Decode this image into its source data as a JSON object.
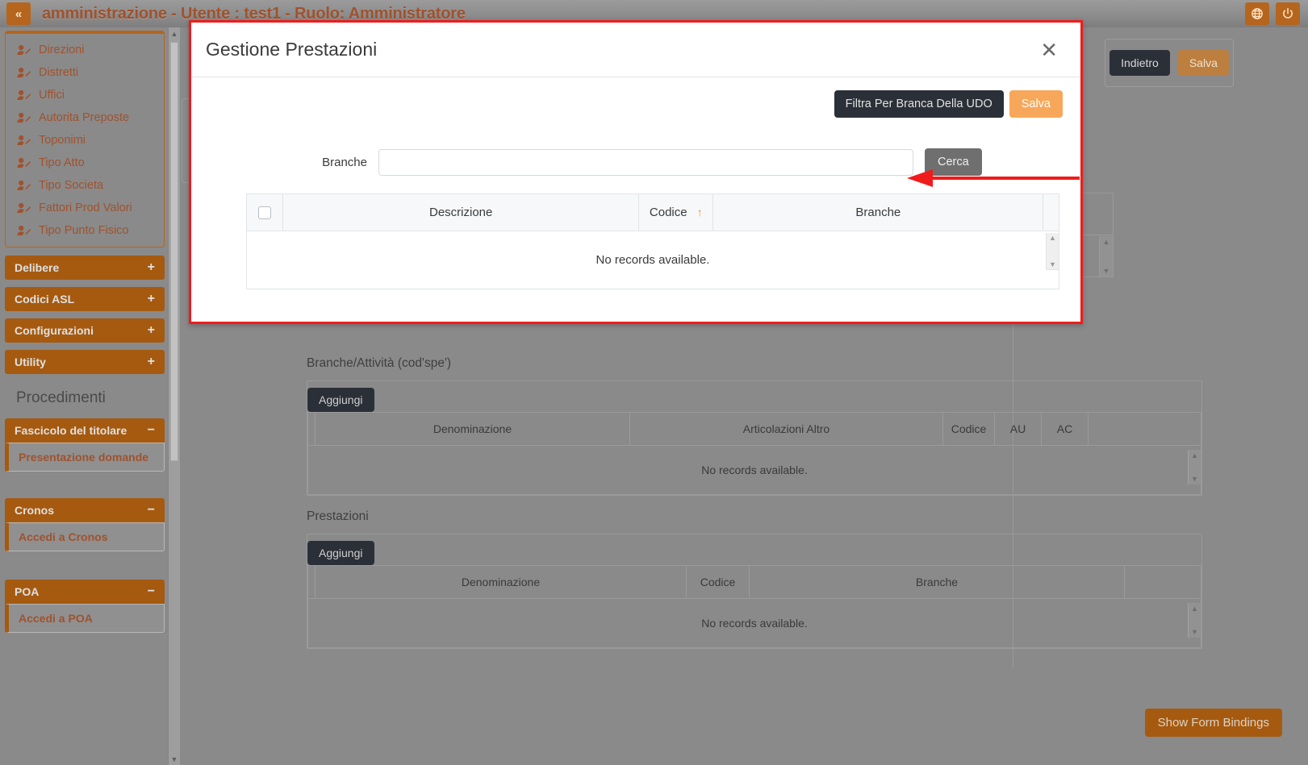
{
  "topbar": {
    "collapse_icon": "double-chevron-left-icon",
    "title": "amministrazione - Utente : test1 - Ruolo: Amministratore",
    "globe_icon": "globe-icon",
    "power_icon": "power-icon"
  },
  "sidebar": {
    "nav_items": [
      {
        "label": "Direzioni",
        "icon": "user-edit-icon"
      },
      {
        "label": "Distretti",
        "icon": "user-edit-icon"
      },
      {
        "label": "Uffici",
        "icon": "user-edit-icon"
      },
      {
        "label": "Autorita Preposte",
        "icon": "user-edit-icon"
      },
      {
        "label": "Toponimi",
        "icon": "user-edit-icon"
      },
      {
        "label": "Tipo Atto",
        "icon": "user-edit-icon"
      },
      {
        "label": "Tipo Societa",
        "icon": "user-edit-icon"
      },
      {
        "label": "Fattori Prod Valori",
        "icon": "user-edit-icon"
      },
      {
        "label": "Tipo Punto Fisico",
        "icon": "user-edit-icon"
      }
    ],
    "collapsed_groups": [
      {
        "label": "Delibere",
        "sign": "+"
      },
      {
        "label": "Codici ASL",
        "sign": "+"
      },
      {
        "label": "Configurazioni",
        "sign": "+"
      },
      {
        "label": "Utility",
        "sign": "+"
      }
    ],
    "section_title": "Procedimenti",
    "expanded_groups": [
      {
        "label": "Fascicolo del titolare",
        "sign": "−",
        "item": "Presentazione domande"
      },
      {
        "label": "Cronos",
        "sign": "−",
        "item": "Accedi a Cronos"
      },
      {
        "label": "POA",
        "sign": "−",
        "item": "Accedi a POA"
      }
    ]
  },
  "main": {
    "toolbar": {
      "back_label": "Indietro",
      "save_label": "Salva"
    },
    "sections": [
      {
        "title": "Branche/Attività (cod'spe')",
        "add_label": "Aggiungi",
        "columns": [
          "",
          "Denominazione",
          "Articolazioni Altro",
          "Codice",
          "AU",
          "AC",
          ""
        ],
        "empty_text": "No records available."
      },
      {
        "title": "Prestazioni",
        "add_label": "Aggiungi",
        "columns": [
          "",
          "Denominazione",
          "Codice",
          "Branche",
          ""
        ],
        "empty_text": "No records available."
      }
    ],
    "show_bindings_label": "Show Form Bindings"
  },
  "modal": {
    "title": "Gestione Prestazioni",
    "close_icon": "close-icon",
    "filter_label": "Filtra Per Branca Della UDO",
    "save_label": "Salva",
    "search": {
      "label": "Branche",
      "value": "",
      "placeholder": "",
      "button_label": "Cerca"
    },
    "table": {
      "columns": [
        "",
        "Descrizione",
        "Codice",
        "Branche",
        ""
      ],
      "sorted_column": "Codice",
      "sort_icon": "sort-asc-arrow-icon",
      "empty_text": "No records available."
    }
  },
  "annotation": {
    "arrow_icon": "red-left-arrow-annotation",
    "color": "#f01c1c"
  },
  "colors": {
    "brand_orange": "#a55a10",
    "accent_orange": "#f7a75a",
    "dark_button": "#2b2f38",
    "annotation_red": "#f01c1c",
    "backdrop": "#8a8a8a"
  }
}
